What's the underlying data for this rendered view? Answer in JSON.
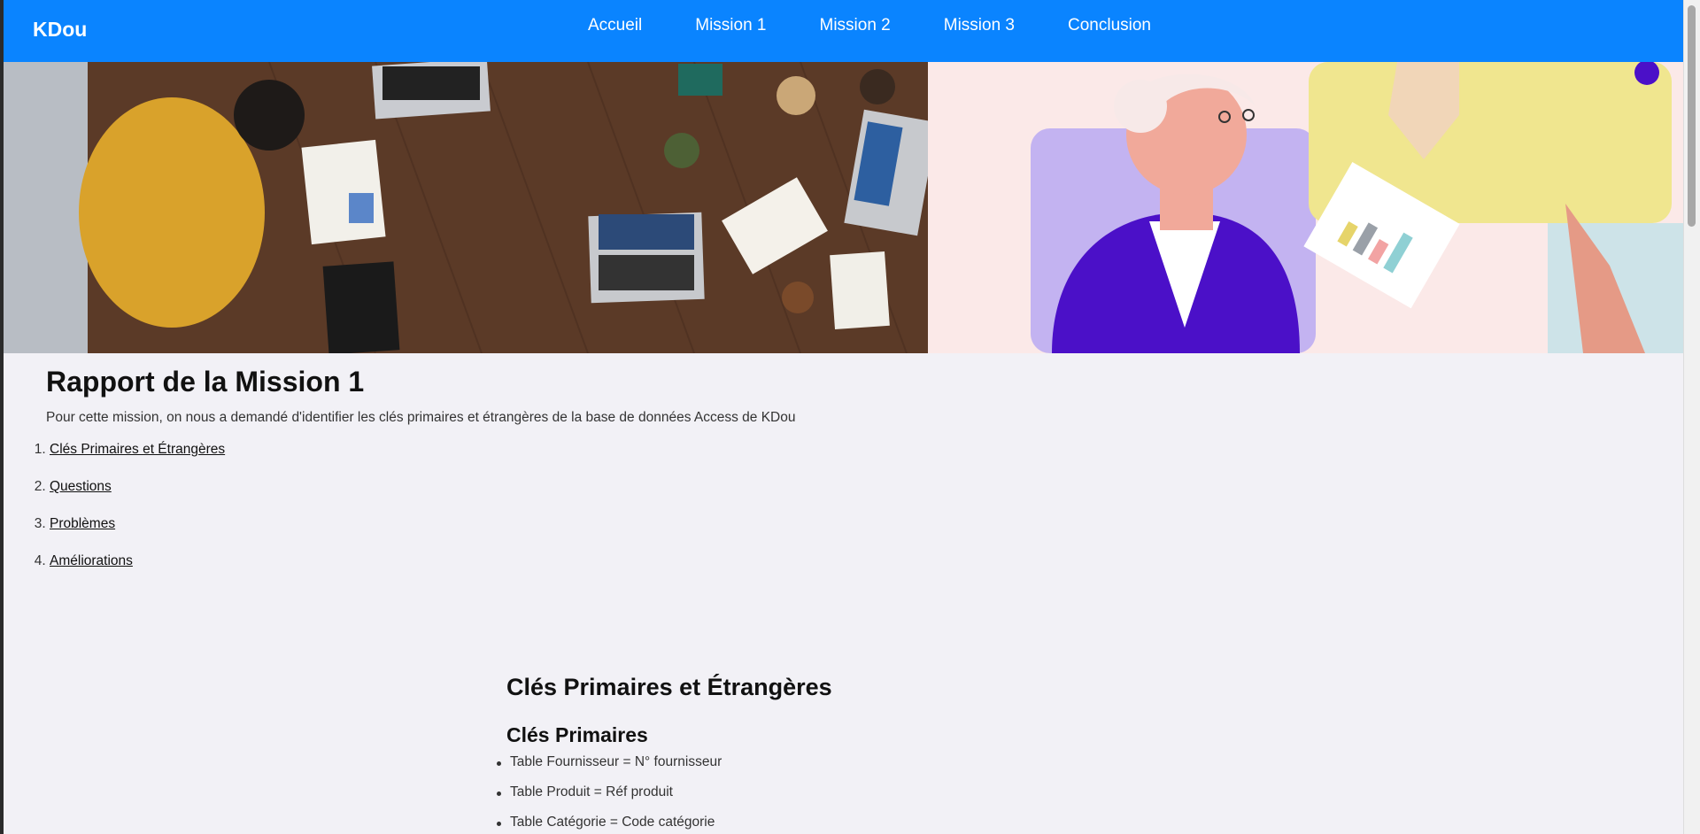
{
  "nav": {
    "logo": "KDou",
    "links": [
      "Accueil",
      "Mission 1",
      "Mission 2",
      "Mission 3",
      "Conclusion"
    ]
  },
  "page": {
    "title": "Rapport de la Mission 1",
    "intro": "Pour cette mission, on nous a demandé d'identifier les clés primaires et étrangères de la base de données Access de KDou"
  },
  "toc": [
    {
      "num": "1.",
      "label": "Clés Primaires et Étrangères"
    },
    {
      "num": "2.",
      "label": "Questions"
    },
    {
      "num": "3.",
      "label": "Problèmes"
    },
    {
      "num": "4.",
      "label": "Améliorations"
    }
  ],
  "section": {
    "title": "Clés Primaires et Étrangères",
    "subtitle": "Clés Primaires",
    "items": [
      "Table Fournisseur = N° fournisseur",
      "Table Produit = Réf produit",
      "Table Catégorie = Code catégorie"
    ]
  },
  "colors": {
    "nav": "#0a84ff",
    "background": "#f2f1f6"
  }
}
